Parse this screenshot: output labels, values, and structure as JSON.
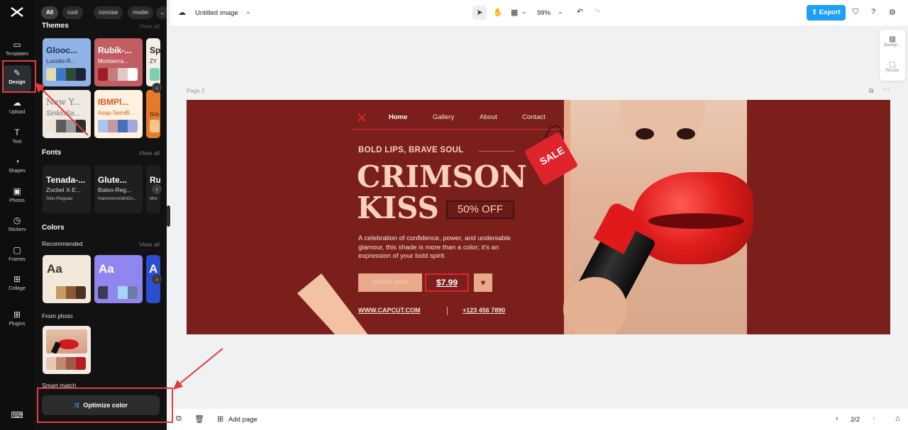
{
  "rail": {
    "items": [
      {
        "label": "Templates"
      },
      {
        "label": "Design"
      },
      {
        "label": "Upload"
      },
      {
        "label": "Text"
      },
      {
        "label": "Shapes"
      },
      {
        "label": "Photos"
      },
      {
        "label": "Stickers"
      },
      {
        "label": "Frames"
      },
      {
        "label": "Collage"
      },
      {
        "label": "Plugins"
      }
    ]
  },
  "panel": {
    "chips": [
      "All",
      "cool",
      "concise",
      "moder"
    ],
    "themes": {
      "title": "Themes",
      "view_all": "View all",
      "cards": [
        {
          "t1": "Glooc...",
          "t2": "Lucette-R...",
          "bg": "#8fb3e6",
          "fg": "#1b2f57",
          "swatches": [
            "#e3dcae",
            "#3c78c9",
            "#2e4a39",
            "#1c2433"
          ]
        },
        {
          "t1": "Rubik-...",
          "t2": "Montserra...",
          "bg": "#c25e63",
          "fg": "#ffffff",
          "swatches": [
            "#9d1e27",
            "#c77a7e",
            "#e0c8ca",
            "#ffffff"
          ]
        },
        {
          "t1": "Sp",
          "t2": "ZY",
          "bg": "#f3efe4",
          "fg": "#222222",
          "swatches": [
            "#7ed0b3"
          ]
        },
        {
          "t1": "New Y...",
          "t2": "SinkinSa...",
          "bg": "#efe9e0",
          "fg": "#777777",
          "swatches": [
            "#ece6d5",
            "#5c5c5c",
            "#9a9a9a",
            "#2d2d2d"
          ]
        },
        {
          "t1": "IBMPl...",
          "t2": "Asap-SemiB...",
          "bg": "#fff3df",
          "fg": "#d9571c",
          "swatches": [
            "#aac4ef",
            "#c49aa0",
            "#4a6fbf",
            "#a1a5e0"
          ]
        },
        {
          "t1": "",
          "t2": "Gro",
          "bg": "#e57a2b",
          "fg": "#111111",
          "swatches": [
            "#f3c48b"
          ]
        }
      ]
    },
    "fonts": {
      "title": "Fonts",
      "view_all": "View all",
      "cards": [
        {
          "f1": "Tenada-...",
          "f2": "Zocbel X-E...",
          "f3": "Stilu-Regular"
        },
        {
          "f1": "Glute...",
          "f2": "Baloo-Reg...",
          "f3": "HammersmithOn..."
        },
        {
          "f1": "Ru",
          "f2": "",
          "f3": "Mor"
        }
      ]
    },
    "colors": {
      "title": "Colors",
      "recommended": "Recommended",
      "view_all": "View all",
      "cards": [
        {
          "aa": "Aa",
          "bg": "#f2e9da",
          "fg": "#4a3322",
          "swatches": [
            "#f2e9da",
            "#c79a62",
            "#8a5a36",
            "#4a3322"
          ]
        },
        {
          "aa": "Aa",
          "bg": "#8f86ef",
          "fg": "#ffffff",
          "swatches": [
            "#3e3b52",
            "#8f86ef",
            "#a4d6f7",
            "#6a7ea8"
          ]
        },
        {
          "aa": "A",
          "bg": "#2d4ed3",
          "fg": "#ffffff",
          "swatches": []
        }
      ],
      "from_photo": "From photo",
      "photo_swatches": [
        "#eac6b4",
        "#bf8a72",
        "#a05a48",
        "#b81c1f"
      ]
    },
    "smart_match": "Smart match",
    "optimize_label": "Optimize color"
  },
  "topbar": {
    "doc_title": "Untitled image",
    "zoom": "99%",
    "export_label": "Export"
  },
  "side_pop": {
    "background": "Backgr...",
    "resize": "Resize"
  },
  "page_label": "Page 2",
  "canvas": {
    "nav": [
      "Home",
      "Gallery",
      "About",
      "Contact"
    ],
    "tagline": "BOLD LIPS, BRAVE SOUL",
    "headline1": "CRIMSON",
    "headline2": "KISS",
    "discount": "50% OFF",
    "description_lines": [
      "A celebration of confidence, power, and undeniable",
      "glamour, this shade is more than a color; it's an",
      "expression of your bold spirit."
    ],
    "order_label": "ORDER NOW",
    "price": "$7.99",
    "website": "WWW.CAPCUT.COM",
    "phone": "+123 456 7890",
    "sale_tag": "SALE",
    "colors": {
      "bg": "#7b1f1c",
      "accent": "#f7d2b8",
      "tag": "#e0242c"
    }
  },
  "bottombar": {
    "add_page": "Add page",
    "pagination": "2/2"
  }
}
